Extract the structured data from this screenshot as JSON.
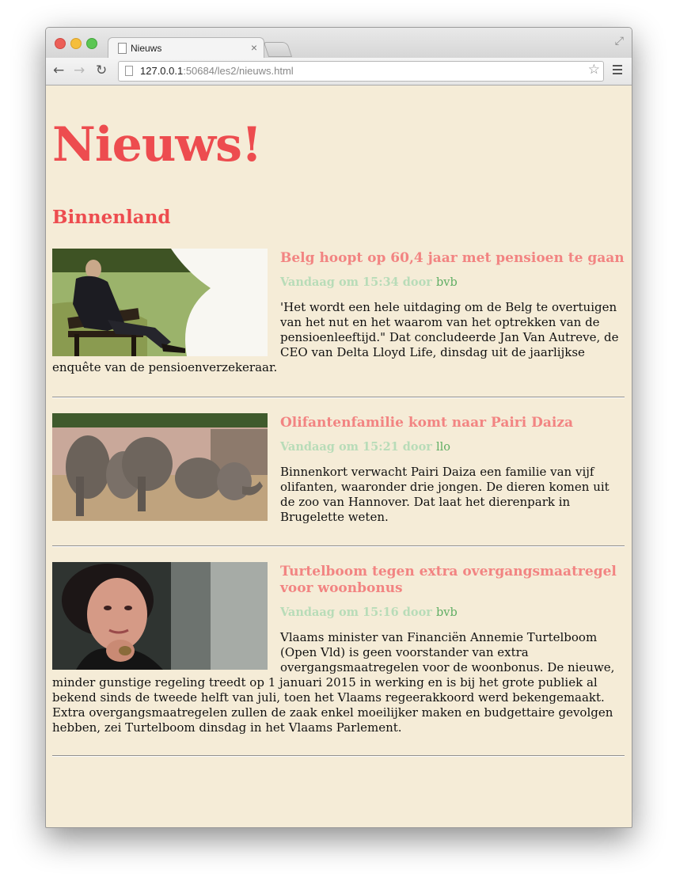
{
  "browser": {
    "tab_title": "Nieuws",
    "tab_close": "×",
    "url_host": "127.0.0.1",
    "url_rest": ":50684/les2/nieuws.html"
  },
  "page": {
    "title": "Nieuws!",
    "section": "Binnenland",
    "articles": [
      {
        "headline": "Belg hoopt op 60,4 jaar met pensioen te gaan",
        "meta": "Vandaag om 15:34 door",
        "author": "bvb",
        "body": "'Het wordt een hele uitdaging om de Belg te overtuigen van het nut en het waarom van het optrekken van de pensioenleeftijd.\" Dat concludeerde Jan Van Autreve, de CEO van Delta Lloyd Life, dinsdag uit de jaarlijkse enquête van de pensioenverzekeraar."
      },
      {
        "headline": "Olifantenfamilie komt naar Pairi Daiza",
        "meta": "Vandaag om 15:21 door",
        "author": "llo",
        "body": "Binnenkort verwacht Pairi Daiza een familie van vijf olifanten, waaronder drie jongen. De dieren komen uit de zoo van Hannover. Dat laat het dierenpark in Brugelette weten."
      },
      {
        "headline": "Turtelboom tegen extra overgangsmaatregel voor woonbonus",
        "meta": "Vandaag om 15:16 door",
        "author": "bvb",
        "body": "Vlaams minister van Financiën Annemie Turtelboom (Open Vld) is geen voorstander van extra overgangsmaatregelen voor de woonbonus. De nieuwe, minder gunstige regeling treedt op 1 januari 2015 in werking en is bij het grote publiek al bekend sinds de tweede helft van juli, toen het Vlaams regeerakkoord werd bekengemaakt. Extra overgangsmaatregelen zullen de zaak enkel moeilijker maken en budgettaire gevolgen hebben, zei Turtelboom dinsdag in het Vlaams Parlement."
      }
    ]
  },
  "colors": {
    "page_bg": "#f5ecd7",
    "title": "#ed4c4f",
    "headline": "#f28482",
    "meta": "#b8dcb8",
    "author": "#5fae64"
  }
}
